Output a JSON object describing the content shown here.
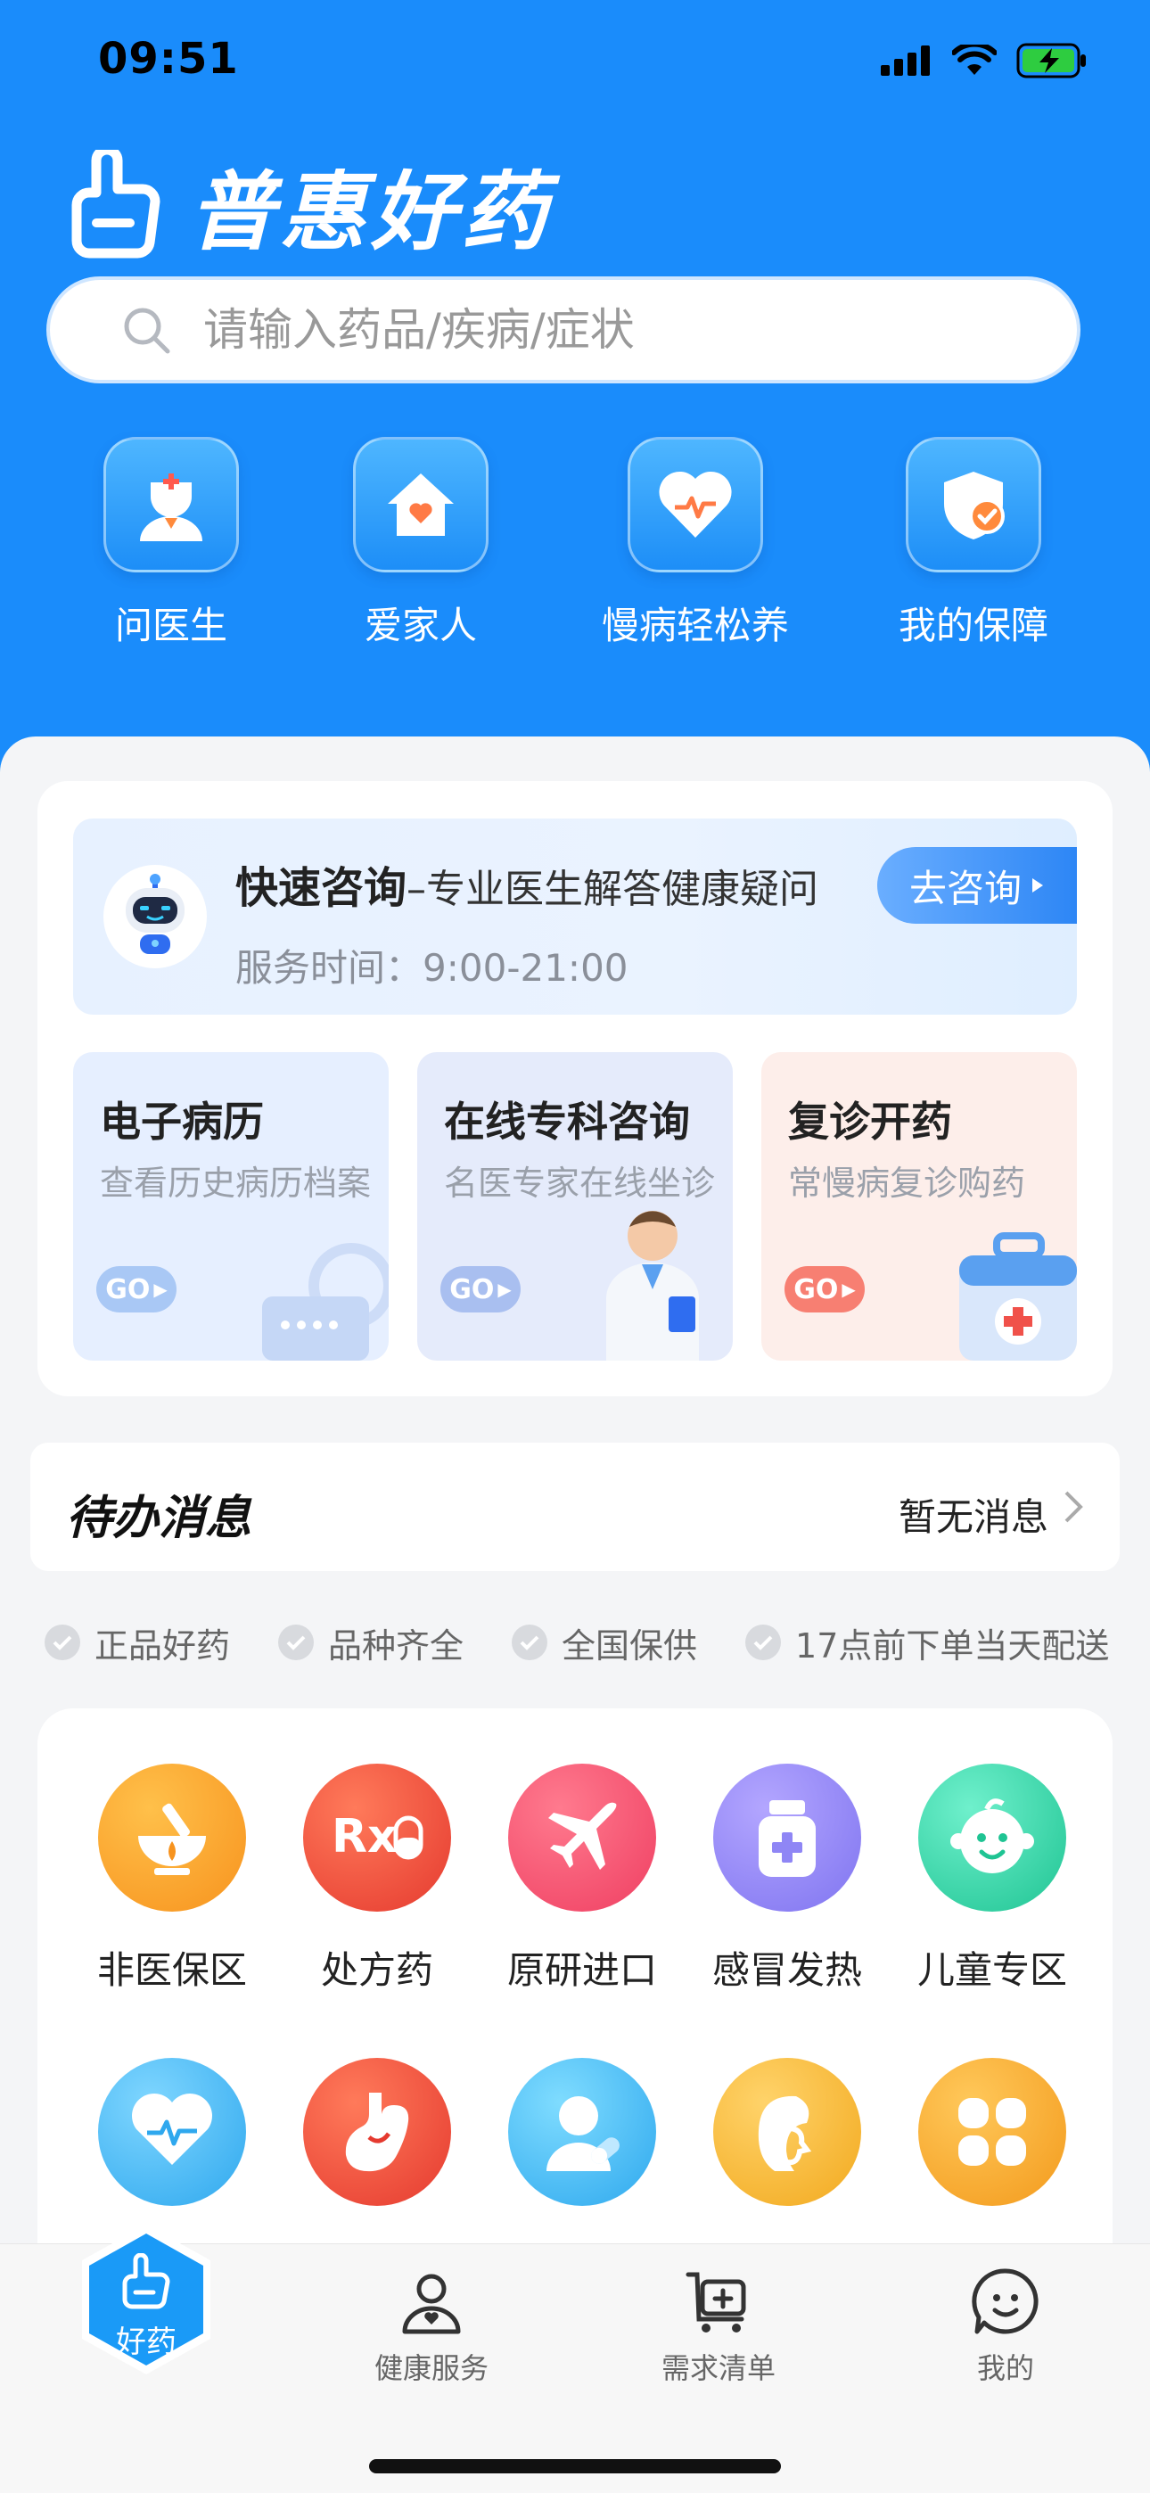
{
  "status": {
    "time": "09:51"
  },
  "brand": {
    "name": "普惠好药"
  },
  "search": {
    "placeholder": "请输入药品/疾病/症状"
  },
  "quick_actions": [
    {
      "label": "问医生",
      "icon": "doctor-icon"
    },
    {
      "label": "爱家人",
      "icon": "home-heart-icon"
    },
    {
      "label": "慢病轻松养",
      "icon": "heart-pulse-icon"
    },
    {
      "label": "我的保障",
      "icon": "shield-check-icon"
    }
  ],
  "consult": {
    "title": "快速咨询",
    "title_rest": "–专业医生解答健康疑问",
    "hours": "服务时间：9:00-21:00",
    "button": "去咨询"
  },
  "services": [
    {
      "title": "电子病历",
      "sub": "查看历史病历档案",
      "go": "GO"
    },
    {
      "title": "在线专科咨询",
      "sub": "名医专家在线坐诊",
      "go": "GO"
    },
    {
      "title": "复诊开药",
      "sub": "常慢病复诊购药",
      "go": "GO"
    }
  ],
  "todo": {
    "title": "待办消息",
    "status": "暂无消息"
  },
  "features": [
    "正品好药",
    "品种齐全",
    "全国保供",
    "17点前下单当天配送"
  ],
  "categories": [
    {
      "label": "非医保区",
      "icon": "mortar-icon",
      "color": "#f7931e"
    },
    {
      "label": "处方药",
      "icon": "rx-icon",
      "color": "#ee4a3c"
    },
    {
      "label": "原研进口",
      "icon": "airplane-icon",
      "color": "#f24e6e"
    },
    {
      "label": "感冒发热",
      "icon": "medicine-bottle-icon",
      "color": "#8f86f5"
    },
    {
      "label": "儿童专区",
      "icon": "baby-face-icon",
      "color": "#2fd3a6"
    },
    {
      "label": "",
      "icon": "heart-monitor-icon",
      "color": "#3cb2f2"
    },
    {
      "label": "",
      "icon": "stomach-icon",
      "color": "#ee4a3c"
    },
    {
      "label": "",
      "icon": "male-pill-icon",
      "color": "#36b6f0"
    },
    {
      "label": "",
      "icon": "female-profile-icon",
      "color": "#f5b534"
    },
    {
      "label": "",
      "icon": "grid-icon",
      "color": "#f7a92b"
    }
  ],
  "tabs": [
    {
      "label": "好药",
      "icon": "thumb-icon"
    },
    {
      "label": "健康服务",
      "icon": "person-heart-icon"
    },
    {
      "label": "需求清单",
      "icon": "cart-list-icon"
    },
    {
      "label": "我的",
      "icon": "smile-chat-icon"
    }
  ]
}
